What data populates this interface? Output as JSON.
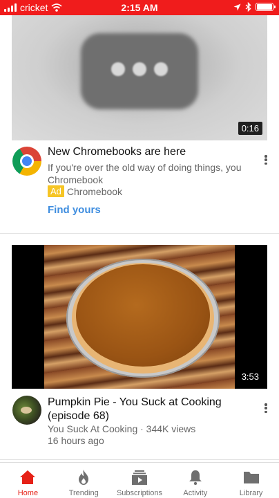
{
  "status_bar": {
    "carrier": "cricket",
    "time": "2:15 AM",
    "icons": [
      "signal-icon",
      "wifi-icon",
      "location-icon",
      "bluetooth-icon",
      "battery-icon"
    ]
  },
  "ad": {
    "duration": "0:16",
    "title": "New Chromebooks are here",
    "description": "If you're over the old way of doing things, you Chromebook",
    "badge": "Ad",
    "advertiser": "Chromebook",
    "cta": "Find yours"
  },
  "video": {
    "duration": "3:53",
    "title": "Pumpkin Pie - You Suck at Cooking (episode 68)",
    "channel_views": "You Suck At Cooking · 344K views",
    "age": "16 hours ago"
  },
  "nav": {
    "items": [
      {
        "label": "Home",
        "icon": "home-icon",
        "active": true
      },
      {
        "label": "Trending",
        "icon": "flame-icon",
        "active": false
      },
      {
        "label": "Subscriptions",
        "icon": "subscriptions-icon",
        "active": false
      },
      {
        "label": "Activity",
        "icon": "bell-icon",
        "active": false
      },
      {
        "label": "Library",
        "icon": "folder-icon",
        "active": false
      }
    ]
  },
  "colors": {
    "brand_red": "#f01c1c",
    "nav_active": "#e62117",
    "link_blue": "#3e8ddf",
    "ad_badge": "#f6c525"
  }
}
